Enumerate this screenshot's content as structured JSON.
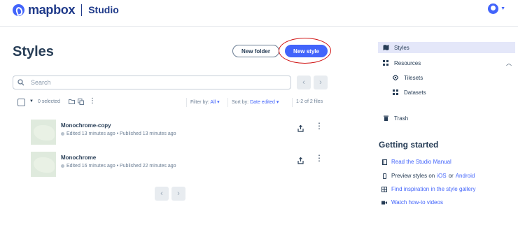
{
  "header": {
    "brand": "mapbox",
    "product": "Studio",
    "icons": {
      "logo": "mapbox-logo-icon",
      "avatar": "account-avatar-icon",
      "caret": "chevron-down-icon"
    }
  },
  "main": {
    "title": "Styles",
    "buttons": {
      "new_folder": "New folder",
      "new_style": "New style"
    },
    "search": {
      "placeholder": "Search",
      "value": ""
    },
    "toolbar": {
      "selected": "0 selected",
      "filter_label": "Filter by:",
      "filter_value": "All",
      "sort_label": "Sort by:",
      "sort_value": "Date edited",
      "count": "1-2 of 2 files"
    },
    "styles": [
      {
        "name": "Monochrome-copy",
        "meta": "Edited 13 minutes ago • Published 13 minutes ago"
      },
      {
        "name": "Monochrome",
        "meta": "Edited 16 minutes ago • Published 22 minutes ago"
      }
    ]
  },
  "sidebar": {
    "items": [
      {
        "label": "Styles",
        "icon": "styles-icon",
        "active": true
      },
      {
        "label": "Resources",
        "icon": "grid-icon"
      },
      {
        "label": "Tilesets",
        "icon": "tileset-icon"
      },
      {
        "label": "Datasets",
        "icon": "grid-icon"
      },
      {
        "label": "Trash",
        "icon": "trash-icon"
      }
    ]
  },
  "getting_started": {
    "title": "Getting started",
    "manual": "Read the Studio Manual",
    "preview_prefix": "Preview styles on",
    "preview_ios": "iOS",
    "preview_or": "or",
    "preview_android": "Android",
    "gallery": "Find inspiration in the style gallery",
    "videos": "Watch how-to videos"
  },
  "colors": {
    "accent": "#4264fb",
    "text": "#273d56",
    "muted": "#6a7d93",
    "annotation": "#d01515"
  }
}
